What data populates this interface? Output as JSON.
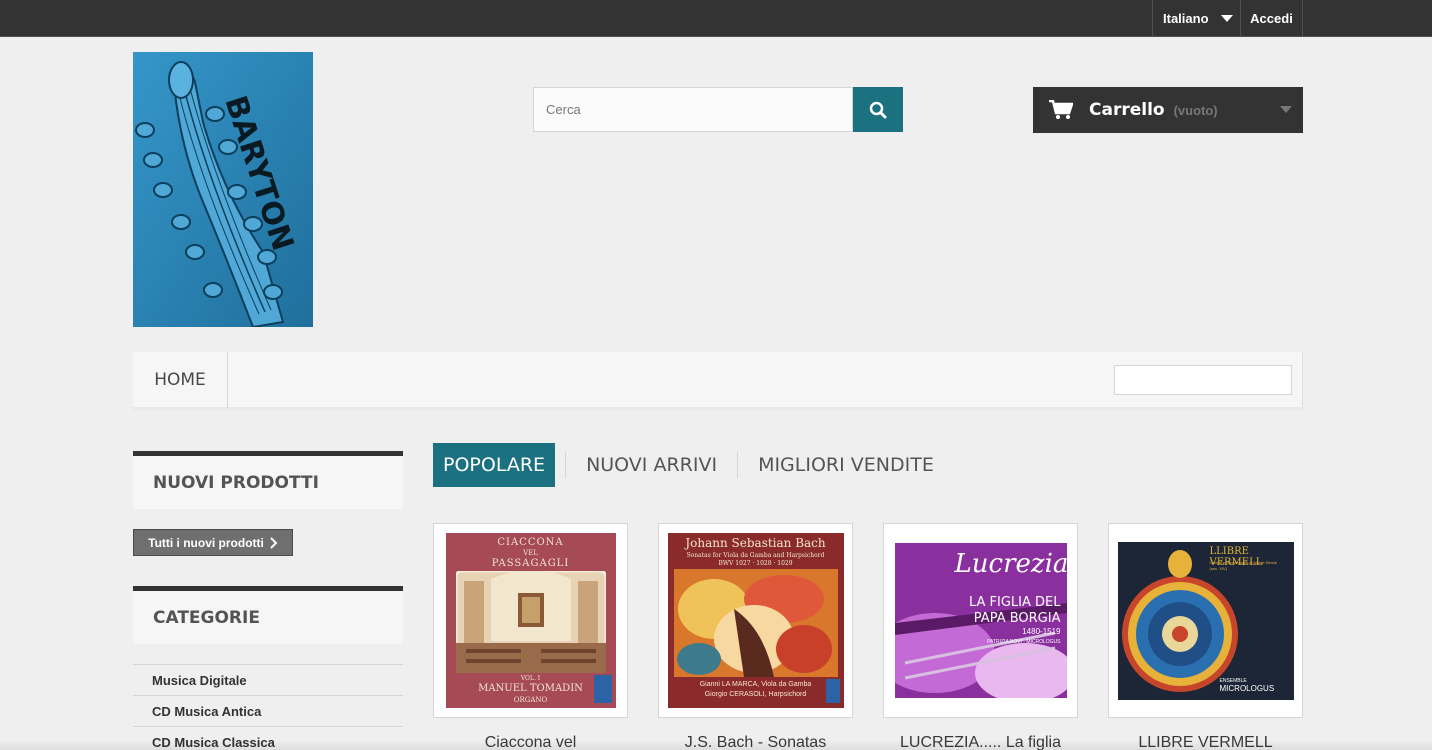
{
  "topbar": {
    "language": "Italiano",
    "login": "Accedi"
  },
  "logo": {
    "text": "BARYTON"
  },
  "search": {
    "placeholder": "Cerca"
  },
  "cart": {
    "label": "Carrello",
    "status": "(vuoto)"
  },
  "menu": {
    "home": "HOME"
  },
  "sidebar": {
    "new_products_title": "NUOVI PRODOTTI",
    "all_new_button": "Tutti i nuovi prodotti",
    "categories_title": "CATEGORIE",
    "categories": [
      "Musica Digitale",
      "CD Musica Antica",
      "CD Musica Classica"
    ]
  },
  "tabs": [
    "POPOLARE",
    "NUOVI ARRIVI",
    "MIGLIORI VENDITE"
  ],
  "products": [
    {
      "name": "Ciaccona vel",
      "cover": {
        "line1": "CIACCONA",
        "line2": "VEL",
        "line3": "PASSAGAGLI",
        "bottom1": "MANUEL TOMADIN",
        "bottom2": "ORGANO",
        "vol": "VOL. I"
      }
    },
    {
      "name": "J.S. Bach - Sonatas",
      "cover": {
        "line1": "Johann Sebastian Bach",
        "line2": "Sonatas for Viola da Gamba and Harpsichord",
        "line3": "BWV 1027 · 1028 · 1029",
        "bottom1": "Gianni LA MARCA, Viola da Gamba",
        "bottom2": "Giorgio CERASOLI, Harpsichord"
      }
    },
    {
      "name": "LUCREZIA..... La figlia",
      "cover": {
        "line1": "Lucrezia",
        "line2": "LA FIGLIA DEL",
        "line3": "PAPA BORGIA",
        "years": "1480-1519",
        "bottom1": "PATRIZIA BOVI · MICROLOGUS"
      }
    },
    {
      "name": "LLIBRE VERMELL",
      "cover": {
        "line1": "LLIBRE VERMELL",
        "line2": "Cant di pellegrinaggio al Monte Serrat",
        "line3": "(sec. XIV)",
        "bottom1": "ENSEMBLE",
        "bottom2": "MICROLOGUS"
      }
    }
  ],
  "colors": {
    "accent": "#1c7180",
    "dark": "#333333",
    "logo_bg": "#2a86b8"
  }
}
